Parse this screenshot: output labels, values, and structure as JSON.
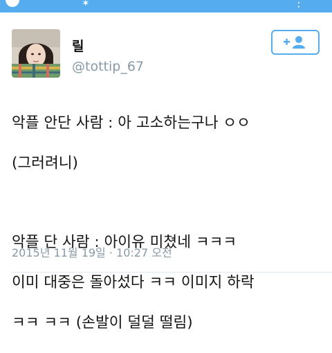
{
  "colors": {
    "accent": "#55acee",
    "muted": "#8899a6",
    "text": "#141414"
  },
  "user": {
    "display_name": "릴",
    "handle": "@tottip_67"
  },
  "follow_button": {
    "icon": "follow-user-icon"
  },
  "tweet": {
    "lines": [
      "악플 안단 사람 : 아 고소하는구나 ㅇㅇ",
      "(그러려니)",
      "",
      "악플 단 사람 : 아이유 미쳤네 ㅋㅋㅋ",
      "이미 대중은 돌아섰다 ㅋㅋ 이미지 하락",
      "ㅋㅋ ㅋㅋ (손발이 덜덜 떨림)"
    ]
  },
  "timestamp": "2015년 11월 19일 · 10:27 오전"
}
